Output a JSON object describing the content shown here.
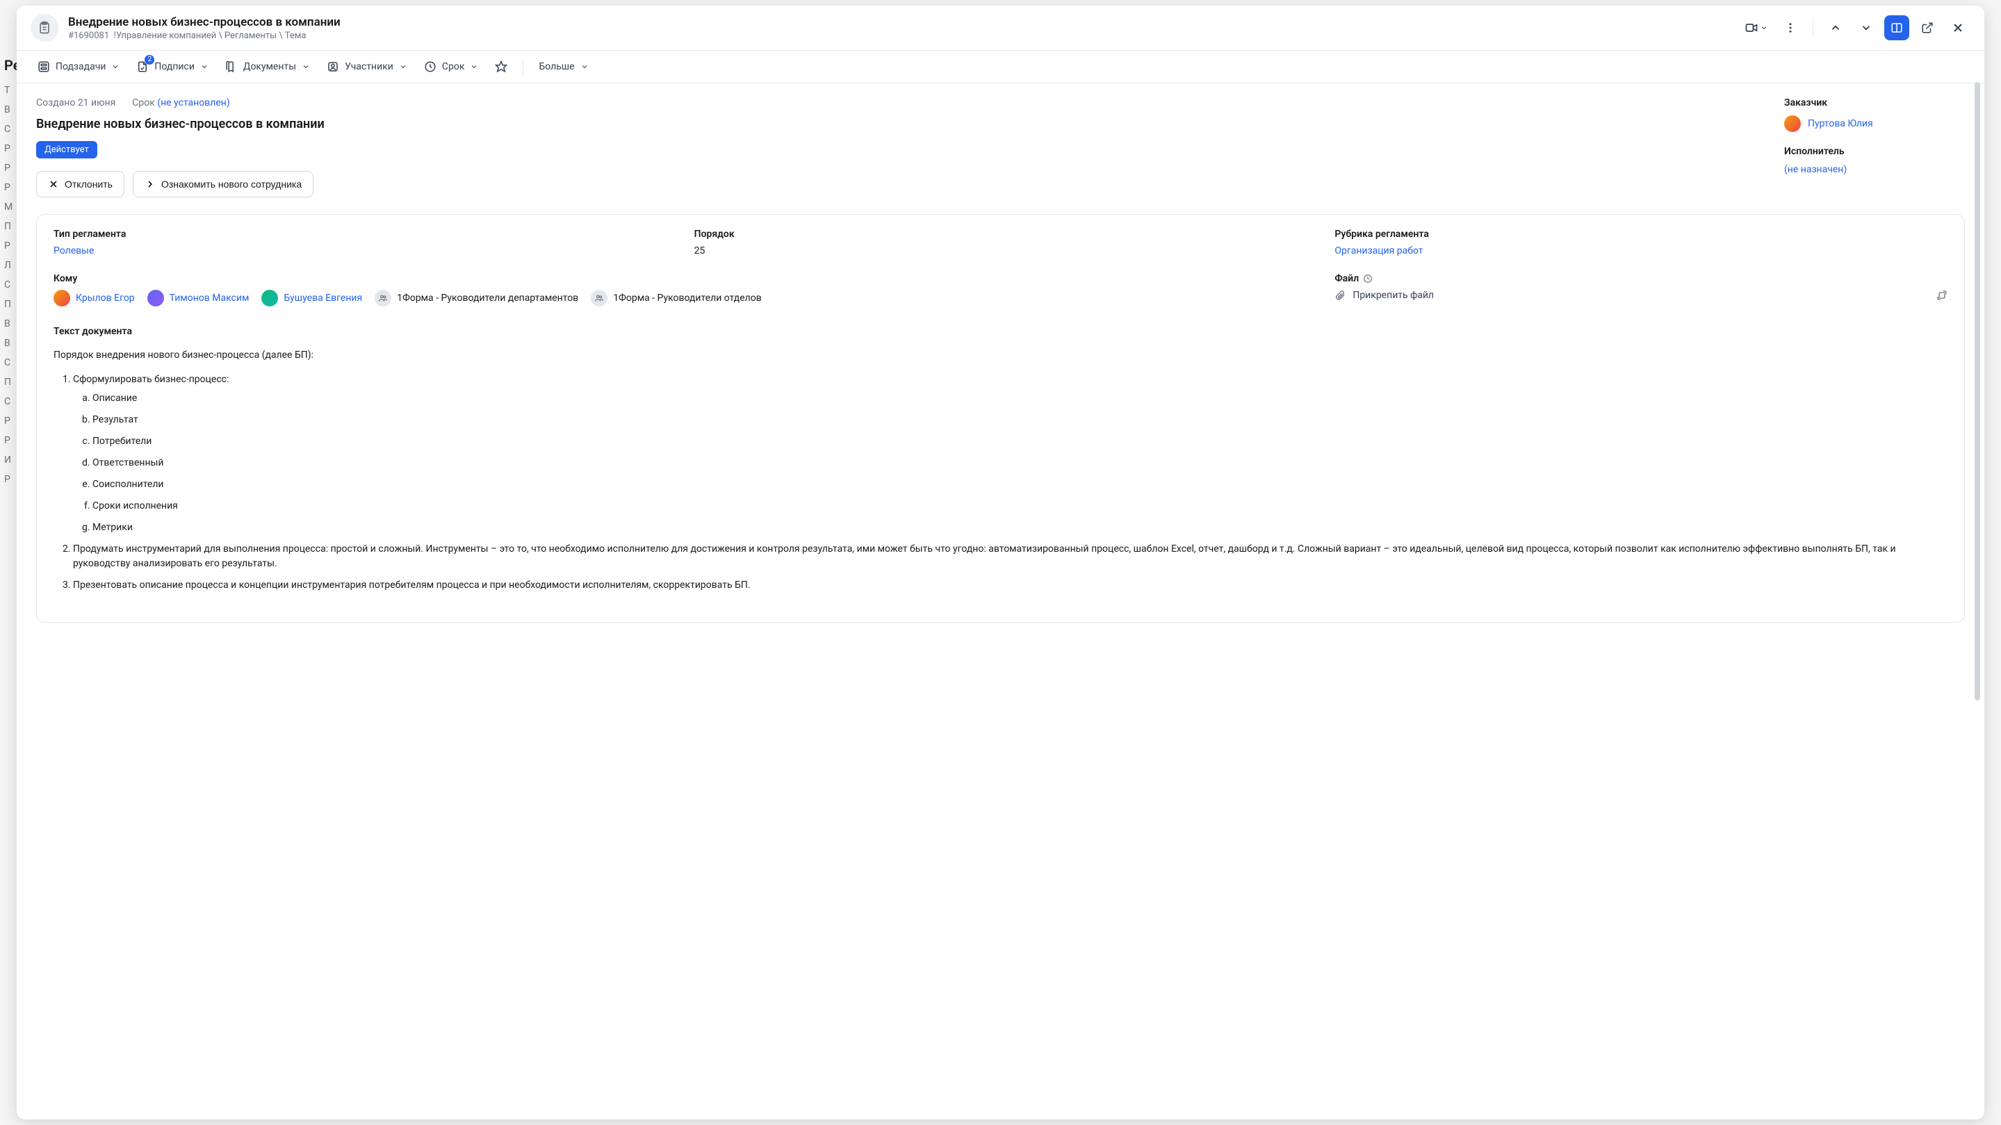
{
  "header": {
    "title": "Внедрение новых бизнес-процессов в компании",
    "id": "#1690081",
    "breadcrumb": "!Управление компанией \\ Регламенты \\ Тема"
  },
  "toolbar": {
    "subtasks": "Подзадачи",
    "signatures": "Подписи",
    "signatures_badge": "2",
    "documents": "Документы",
    "participants": "Участники",
    "deadline": "Срок",
    "more": "Больше"
  },
  "meta": {
    "created_label": "Создано",
    "created_value": "21 июня",
    "deadline_label": "Срок",
    "deadline_value": "(не установлен)"
  },
  "task": {
    "title": "Внедрение новых бизнес-процессов в компании",
    "status": "Действует"
  },
  "actions": {
    "reject": "Отклонить",
    "introduce": "Ознакомить нового сотрудника"
  },
  "side": {
    "customer_label": "Заказчик",
    "customer_name": "Пуртова Юлия",
    "assignee_label": "Исполнитель",
    "assignee_value": "(не назначен)"
  },
  "fields": {
    "type_label": "Тип регламента",
    "type_value": "Ролевые",
    "order_label": "Порядок",
    "order_value": "25",
    "rubric_label": "Рубрика регламента",
    "rubric_value": "Организация работ",
    "to_label": "Кому",
    "file_label": "Файл",
    "attach": "Прикрепить файл"
  },
  "recipients": [
    {
      "name": "Крылов Егор",
      "link": true,
      "avatar": "a"
    },
    {
      "name": "Тимонов Максим",
      "link": true,
      "avatar": "b"
    },
    {
      "name": "Бушуева Евгения",
      "link": true,
      "avatar": "c"
    },
    {
      "name": "1Форма - Руководители департаментов",
      "link": false,
      "avatar": "grp"
    },
    {
      "name": "1Форма - Руководители отделов",
      "link": false,
      "avatar": "grp"
    }
  ],
  "doc": {
    "heading": "Текст документа",
    "intro": "Порядок внедрения нового бизнес-процесса (далее БП):",
    "item1": "Сформулировать бизнес-процесс:",
    "sub": {
      "a": "Описание",
      "b": "Результат",
      "c": "Потребители",
      "d": "Ответственный",
      "e": "Соисполнители",
      "f": "Сроки исполнения",
      "g": "Метрики"
    },
    "item2": "Продумать инструментарий для выполнения процесса: простой и сложный. Инструменты – это то, что необходимо исполнителю для достижения и контроля результата, ими может быть что угодно: автоматизированный процесс, шаблон Excel, отчет, дашборд и т.д. Сложный вариант – это идеальный, целевой вид процесса, который позволит как исполнителю эффективно выполнять БП, так и руководству анализировать его результаты.",
    "item3": "Презентовать описание процесса и концепции инструментария потребителям процесса и при необходимости исполнителям, скорректировать БП."
  },
  "bg_title": "Ре",
  "bg_rows": [
    "Т",
    "В",
    "С",
    "Р",
    "Р",
    "Р",
    "М",
    "П",
    "Р",
    "Л",
    "С",
    "П",
    "В",
    "В",
    "С",
    "П",
    "С",
    "Р",
    "Р",
    "И",
    "Р"
  ]
}
